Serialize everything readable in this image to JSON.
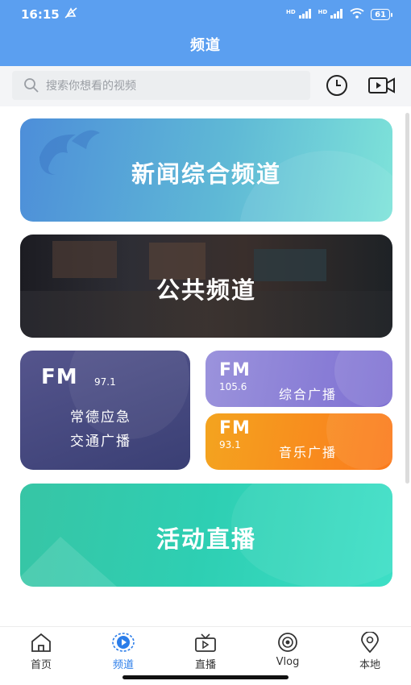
{
  "status_bar": {
    "time": "16:15",
    "network_1": "HD",
    "network_2": "HD",
    "battery": "61"
  },
  "header": {
    "title": "频道"
  },
  "search": {
    "placeholder": "搜索你想看的视频"
  },
  "toolbar": {
    "history_icon": "clock-icon",
    "video_icon": "video-camera-icon"
  },
  "cards": {
    "news": {
      "label": "新闻综合频道"
    },
    "public": {
      "label": "公共频道"
    },
    "fm971": {
      "fm": "FM",
      "freq": "97.1",
      "line1": "常德应急",
      "line2": "交通广播"
    },
    "fm1056": {
      "fm": "FM",
      "freq": "105.6",
      "name": "综合广播"
    },
    "fm931": {
      "fm": "FM",
      "freq": "93.1",
      "name": "音乐广播"
    },
    "live": {
      "label": "活动直播"
    }
  },
  "tabs": [
    {
      "label": "首页",
      "icon": "home-icon",
      "active": false
    },
    {
      "label": "频道",
      "icon": "channel-icon",
      "active": true
    },
    {
      "label": "直播",
      "icon": "live-tv-icon",
      "active": false
    },
    {
      "label": "Vlog",
      "icon": "vlog-icon",
      "active": false
    },
    {
      "label": "本地",
      "icon": "location-pin-icon",
      "active": false
    }
  ],
  "colors": {
    "accent": "#2b7de9",
    "header": "#5b9ff0"
  }
}
